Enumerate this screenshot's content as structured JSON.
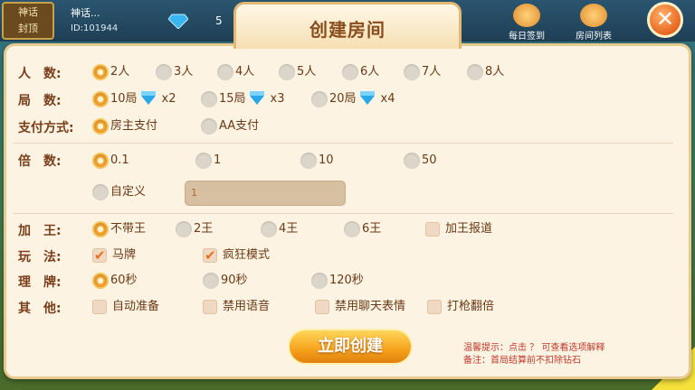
{
  "top": {
    "player_badge": [
      "神话",
      "封顶"
    ],
    "player_name": "神话...",
    "player_id": "ID:101944",
    "gem_count": "5",
    "daily_checkin": "每日签到",
    "room_list": "房间列表"
  },
  "dialog": {
    "title": "创建房间",
    "close_label": "✕"
  },
  "rows": {
    "players": {
      "label": "人　数:",
      "options": [
        "2人",
        "3人",
        "4人",
        "5人",
        "6人",
        "7人",
        "8人"
      ],
      "selected": 0
    },
    "rounds": {
      "label": "局　数:",
      "options": [
        {
          "text": "10局",
          "cost": "x2"
        },
        {
          "text": "15局",
          "cost": "x3"
        },
        {
          "text": "20局",
          "cost": "x4"
        }
      ],
      "selected": 0
    },
    "payment": {
      "label": "支付方式:",
      "options": [
        "房主支付",
        "AA支付"
      ],
      "selected": 0
    },
    "multiplier": {
      "label": "倍　数:",
      "options": [
        "0.1",
        "1",
        "10",
        "50"
      ],
      "selected": 0,
      "custom_label": "自定义",
      "custom_value": "1"
    },
    "kings": {
      "label": "加　王:",
      "options": [
        "不带王",
        "2王",
        "4王",
        "6王"
      ],
      "selected": 0,
      "extra_check": "加王报道"
    },
    "play": {
      "label": "玩　法:",
      "checks": [
        {
          "text": "马牌",
          "on": true
        },
        {
          "text": "疯狂模式",
          "on": true
        }
      ]
    },
    "arrange": {
      "label": "理　牌:",
      "options": [
        "60秒",
        "90秒",
        "120秒"
      ],
      "selected": 0
    },
    "other": {
      "label": "其　他:",
      "checks": [
        {
          "text": "自动准备",
          "on": false
        },
        {
          "text": "禁用语音",
          "on": false
        },
        {
          "text": "禁用聊天表情",
          "on": false
        },
        {
          "text": "打枪翻倍",
          "on": false
        }
      ]
    }
  },
  "create_button": "立即创建",
  "hint_line1": "温馨提示：点击 ？ 可查看选项解释",
  "hint_line2": "备注：首局结算前不扣除钻石"
}
